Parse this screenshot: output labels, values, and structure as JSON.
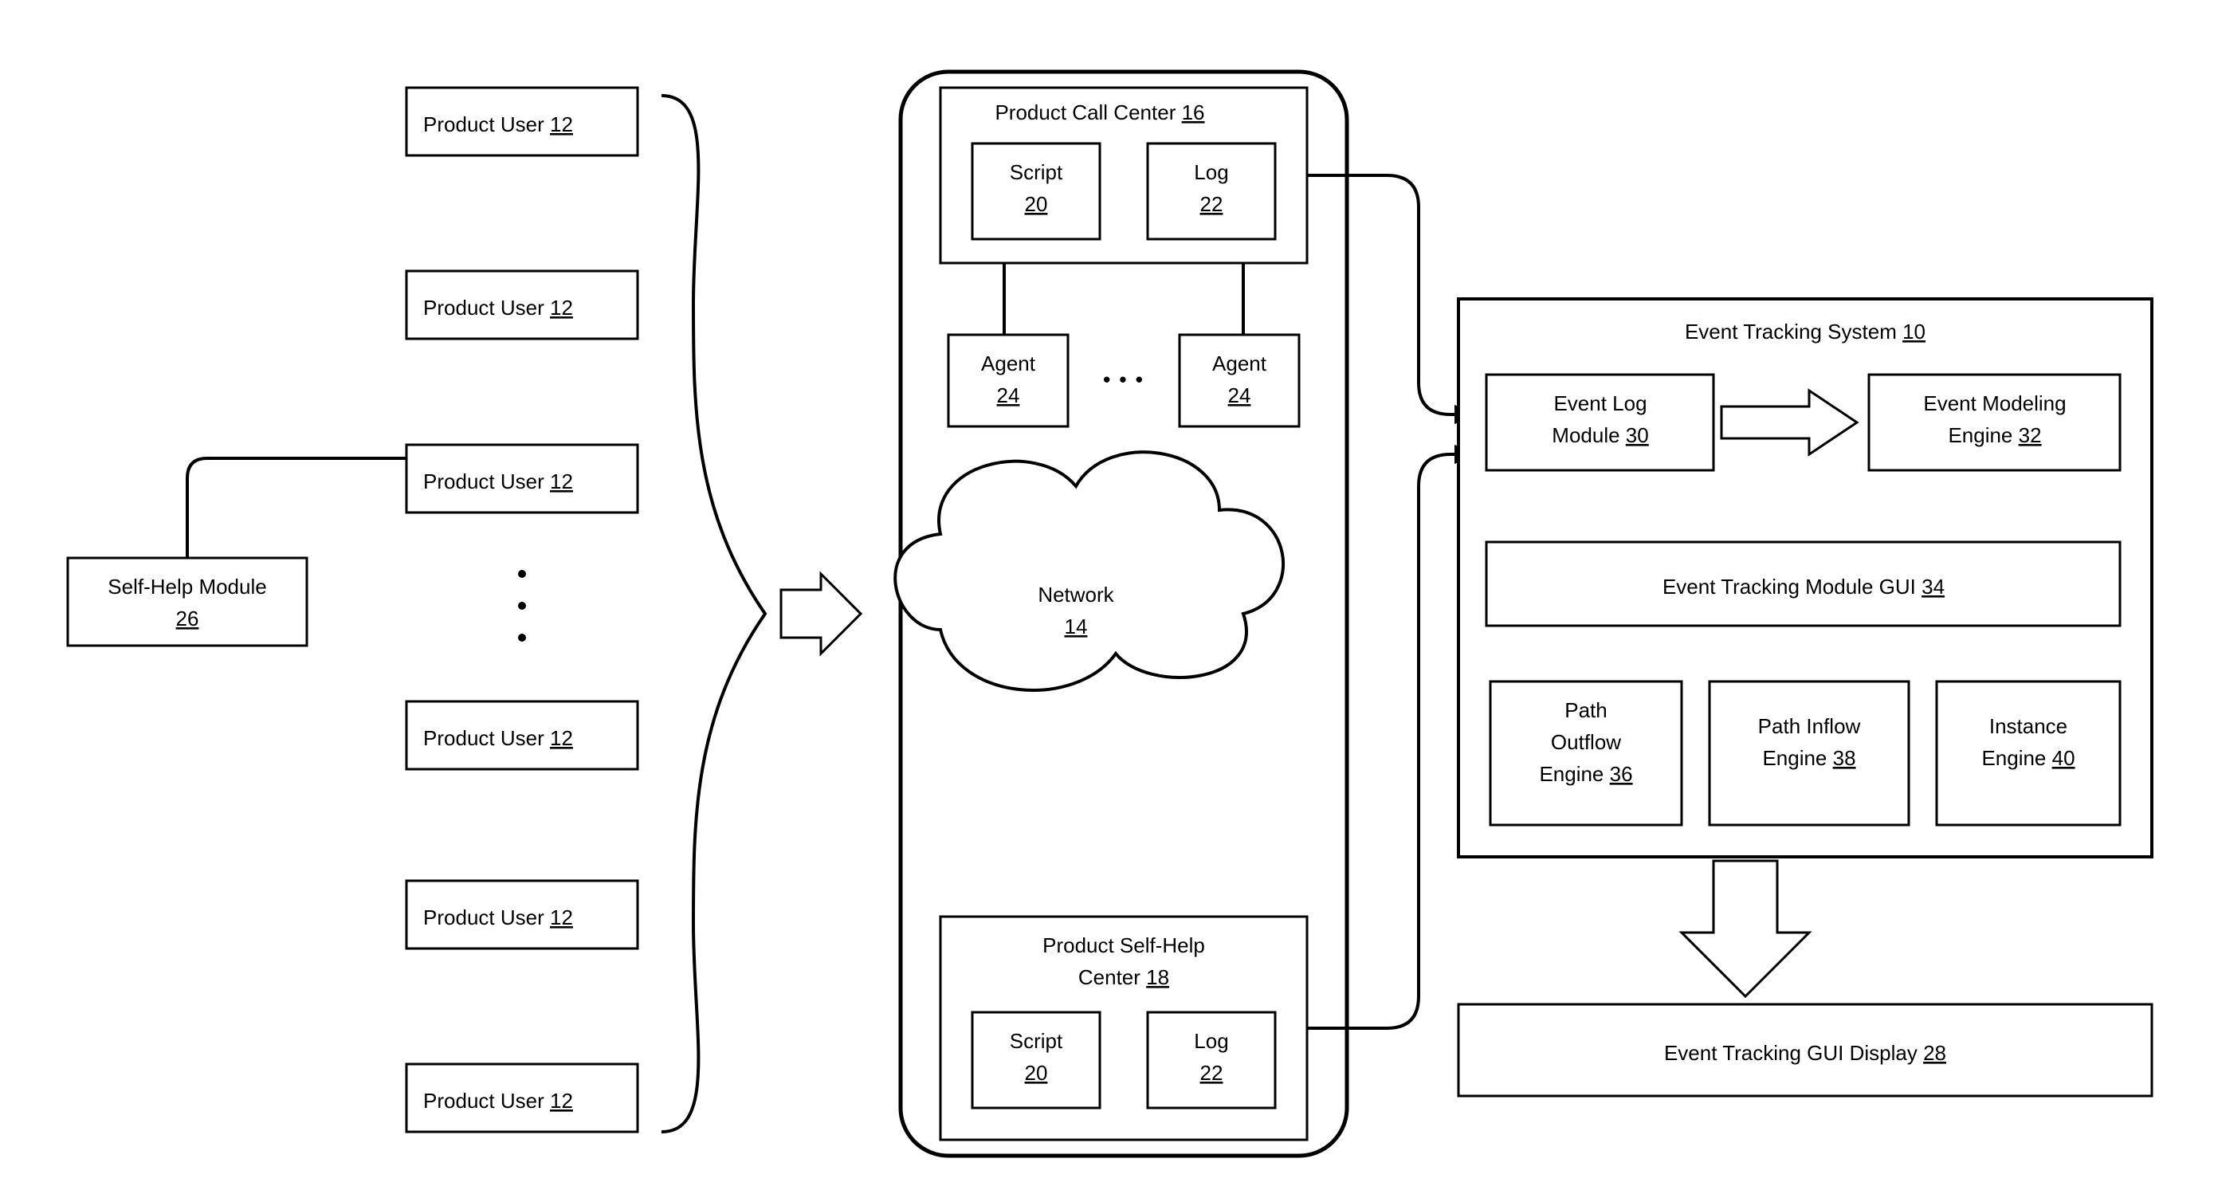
{
  "productUser": {
    "label": "Product User",
    "num": "12"
  },
  "selfHelpModule": {
    "label": "Self-Help Module",
    "num": "26"
  },
  "network": {
    "label": "Network",
    "num": "14"
  },
  "callCenter": {
    "label": "Product Call Center",
    "num": "16"
  },
  "selfHelpCenter": {
    "line1": "Product Self-Help",
    "line2": "Center",
    "num": "18"
  },
  "script": {
    "label": "Script",
    "num": "20"
  },
  "log": {
    "label": "Log",
    "num": "22"
  },
  "agent": {
    "label": "Agent",
    "num": "24"
  },
  "ets": {
    "label": "Event Tracking System",
    "num": "10"
  },
  "eventLogModule": {
    "line1": "Event Log",
    "line2": "Module",
    "num": "30"
  },
  "eventModelingEngine": {
    "line1": "Event Modeling",
    "line2": "Engine",
    "num": "32"
  },
  "etmGui": {
    "label": "Event Tracking Module GUI",
    "num": "34"
  },
  "pathOutflow": {
    "line1": "Path",
    "line2": "Outflow",
    "line3": "Engine",
    "num": "36"
  },
  "pathInflow": {
    "line1": "Path Inflow",
    "line2": "Engine",
    "num": "38"
  },
  "instanceEngine": {
    "line1": "Instance",
    "line2": "Engine",
    "num": "40"
  },
  "etGuiDisplay": {
    "label": "Event Tracking GUI Display",
    "num": "28"
  },
  "dots": "• • •"
}
